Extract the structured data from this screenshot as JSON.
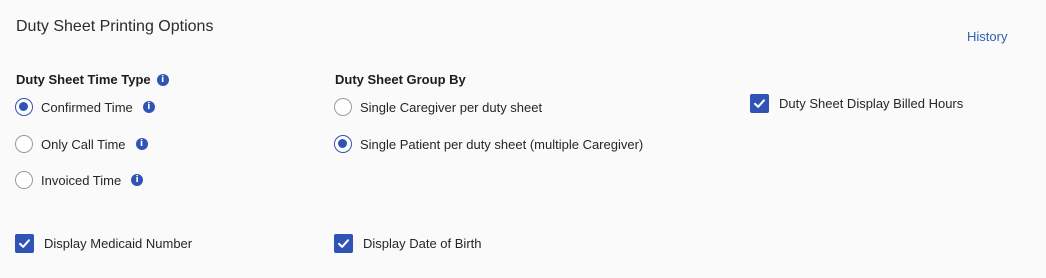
{
  "section": {
    "title": "Duty Sheet Printing Options",
    "history_label": "History"
  },
  "time_type": {
    "label": "Duty Sheet Time Type",
    "info_icon": "info-icon",
    "options": [
      {
        "label": "Confirmed Time",
        "selected": true
      },
      {
        "label": "Only Call Time",
        "selected": false
      },
      {
        "label": "Invoiced Time",
        "selected": false
      }
    ]
  },
  "group_by": {
    "label": "Duty Sheet Group By",
    "options": [
      {
        "label": "Single Caregiver per duty sheet",
        "selected": false
      },
      {
        "label": "Single Patient per duty sheet (multiple Caregiver)",
        "selected": true
      }
    ]
  },
  "checkboxes": {
    "display_billed_hours": {
      "label": "Duty Sheet Display Billed Hours",
      "checked": true
    },
    "display_medicaid_number": {
      "label": "Display Medicaid Number",
      "checked": true
    },
    "display_date_of_birth": {
      "label": "Display Date of Birth",
      "checked": true
    }
  },
  "colors": {
    "accent": "#2f54b5",
    "link": "#2f5fb0",
    "background": "#fafafa"
  }
}
